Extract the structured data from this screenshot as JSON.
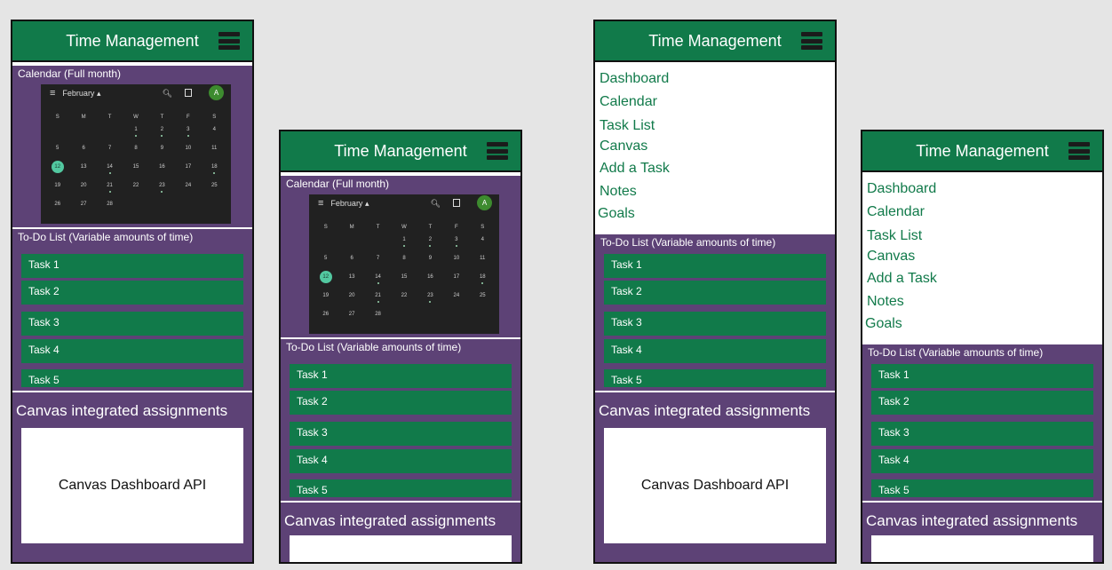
{
  "app": {
    "title": "Time Management",
    "accent_color": "#117a4a",
    "section_color": "#5d4276"
  },
  "calendar": {
    "label": "Calendar (Full month)",
    "month": "February",
    "menu_icon": "menu-icon",
    "avatar_letter": "A",
    "weekdays": [
      "S",
      "M",
      "T",
      "W",
      "T",
      "F",
      "S"
    ],
    "days": [
      "1",
      "2",
      "3",
      "4",
      "5",
      "6",
      "7",
      "8",
      "9",
      "10",
      "11",
      "12",
      "13",
      "14",
      "15",
      "16",
      "17",
      "18",
      "19",
      "20",
      "21",
      "22",
      "23",
      "24",
      "25",
      "26",
      "27",
      "28"
    ],
    "selected_day": "12"
  },
  "todo": {
    "label": "To-Do List (Variable amounts of time)",
    "tasks": [
      "Task 1",
      "Task 2",
      "Task 3",
      "Task 4",
      "Task 5"
    ]
  },
  "canvas": {
    "label": "Canvas integrated assignments",
    "api_text": "Canvas Dashboard API"
  },
  "nav": {
    "items": [
      "Dashboard",
      "Calendar",
      "Task List",
      "Canvas",
      "Add a Task",
      "Notes",
      "Goals"
    ]
  }
}
